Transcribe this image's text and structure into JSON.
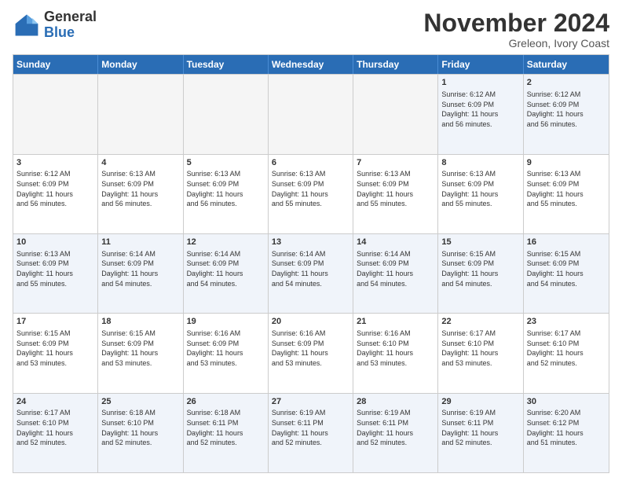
{
  "logo": {
    "general": "General",
    "blue": "Blue"
  },
  "title": "November 2024",
  "location": "Greleon, Ivory Coast",
  "days": [
    "Sunday",
    "Monday",
    "Tuesday",
    "Wednesday",
    "Thursday",
    "Friday",
    "Saturday"
  ],
  "rows": [
    [
      {
        "num": "",
        "text": "",
        "empty": true
      },
      {
        "num": "",
        "text": "",
        "empty": true
      },
      {
        "num": "",
        "text": "",
        "empty": true
      },
      {
        "num": "",
        "text": "",
        "empty": true
      },
      {
        "num": "",
        "text": "",
        "empty": true
      },
      {
        "num": "1",
        "text": "Sunrise: 6:12 AM\nSunset: 6:09 PM\nDaylight: 11 hours\nand 56 minutes."
      },
      {
        "num": "2",
        "text": "Sunrise: 6:12 AM\nSunset: 6:09 PM\nDaylight: 11 hours\nand 56 minutes."
      }
    ],
    [
      {
        "num": "3",
        "text": "Sunrise: 6:12 AM\nSunset: 6:09 PM\nDaylight: 11 hours\nand 56 minutes."
      },
      {
        "num": "4",
        "text": "Sunrise: 6:13 AM\nSunset: 6:09 PM\nDaylight: 11 hours\nand 56 minutes."
      },
      {
        "num": "5",
        "text": "Sunrise: 6:13 AM\nSunset: 6:09 PM\nDaylight: 11 hours\nand 56 minutes."
      },
      {
        "num": "6",
        "text": "Sunrise: 6:13 AM\nSunset: 6:09 PM\nDaylight: 11 hours\nand 55 minutes."
      },
      {
        "num": "7",
        "text": "Sunrise: 6:13 AM\nSunset: 6:09 PM\nDaylight: 11 hours\nand 55 minutes."
      },
      {
        "num": "8",
        "text": "Sunrise: 6:13 AM\nSunset: 6:09 PM\nDaylight: 11 hours\nand 55 minutes."
      },
      {
        "num": "9",
        "text": "Sunrise: 6:13 AM\nSunset: 6:09 PM\nDaylight: 11 hours\nand 55 minutes."
      }
    ],
    [
      {
        "num": "10",
        "text": "Sunrise: 6:13 AM\nSunset: 6:09 PM\nDaylight: 11 hours\nand 55 minutes."
      },
      {
        "num": "11",
        "text": "Sunrise: 6:14 AM\nSunset: 6:09 PM\nDaylight: 11 hours\nand 54 minutes."
      },
      {
        "num": "12",
        "text": "Sunrise: 6:14 AM\nSunset: 6:09 PM\nDaylight: 11 hours\nand 54 minutes."
      },
      {
        "num": "13",
        "text": "Sunrise: 6:14 AM\nSunset: 6:09 PM\nDaylight: 11 hours\nand 54 minutes."
      },
      {
        "num": "14",
        "text": "Sunrise: 6:14 AM\nSunset: 6:09 PM\nDaylight: 11 hours\nand 54 minutes."
      },
      {
        "num": "15",
        "text": "Sunrise: 6:15 AM\nSunset: 6:09 PM\nDaylight: 11 hours\nand 54 minutes."
      },
      {
        "num": "16",
        "text": "Sunrise: 6:15 AM\nSunset: 6:09 PM\nDaylight: 11 hours\nand 54 minutes."
      }
    ],
    [
      {
        "num": "17",
        "text": "Sunrise: 6:15 AM\nSunset: 6:09 PM\nDaylight: 11 hours\nand 53 minutes."
      },
      {
        "num": "18",
        "text": "Sunrise: 6:15 AM\nSunset: 6:09 PM\nDaylight: 11 hours\nand 53 minutes."
      },
      {
        "num": "19",
        "text": "Sunrise: 6:16 AM\nSunset: 6:09 PM\nDaylight: 11 hours\nand 53 minutes."
      },
      {
        "num": "20",
        "text": "Sunrise: 6:16 AM\nSunset: 6:09 PM\nDaylight: 11 hours\nand 53 minutes."
      },
      {
        "num": "21",
        "text": "Sunrise: 6:16 AM\nSunset: 6:10 PM\nDaylight: 11 hours\nand 53 minutes."
      },
      {
        "num": "22",
        "text": "Sunrise: 6:17 AM\nSunset: 6:10 PM\nDaylight: 11 hours\nand 53 minutes."
      },
      {
        "num": "23",
        "text": "Sunrise: 6:17 AM\nSunset: 6:10 PM\nDaylight: 11 hours\nand 52 minutes."
      }
    ],
    [
      {
        "num": "24",
        "text": "Sunrise: 6:17 AM\nSunset: 6:10 PM\nDaylight: 11 hours\nand 52 minutes."
      },
      {
        "num": "25",
        "text": "Sunrise: 6:18 AM\nSunset: 6:10 PM\nDaylight: 11 hours\nand 52 minutes."
      },
      {
        "num": "26",
        "text": "Sunrise: 6:18 AM\nSunset: 6:11 PM\nDaylight: 11 hours\nand 52 minutes."
      },
      {
        "num": "27",
        "text": "Sunrise: 6:19 AM\nSunset: 6:11 PM\nDaylight: 11 hours\nand 52 minutes."
      },
      {
        "num": "28",
        "text": "Sunrise: 6:19 AM\nSunset: 6:11 PM\nDaylight: 11 hours\nand 52 minutes."
      },
      {
        "num": "29",
        "text": "Sunrise: 6:19 AM\nSunset: 6:11 PM\nDaylight: 11 hours\nand 52 minutes."
      },
      {
        "num": "30",
        "text": "Sunrise: 6:20 AM\nSunset: 6:12 PM\nDaylight: 11 hours\nand 51 minutes."
      }
    ]
  ]
}
